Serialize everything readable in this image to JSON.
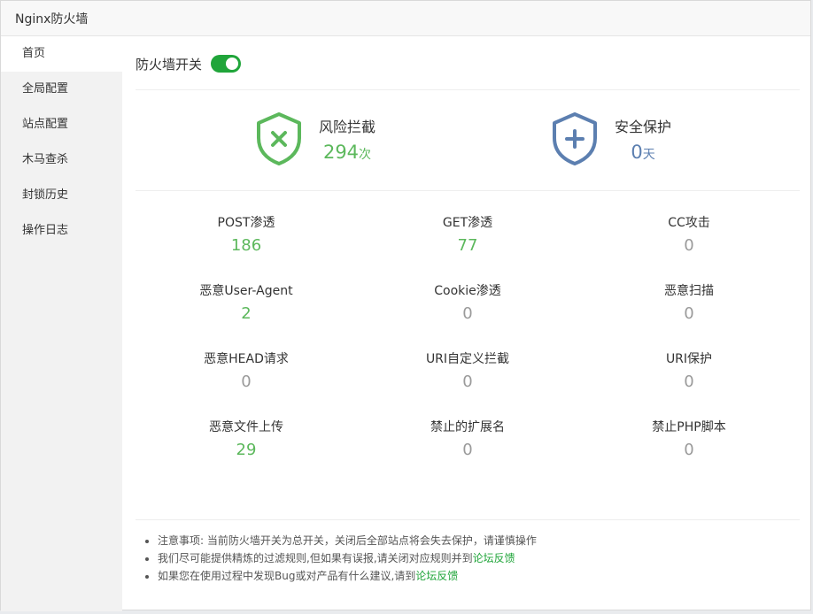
{
  "window": {
    "title": "Nginx防火墙"
  },
  "sidebar": {
    "items": [
      {
        "label": "首页"
      },
      {
        "label": "全局配置"
      },
      {
        "label": "站点配置"
      },
      {
        "label": "木马查杀"
      },
      {
        "label": "封锁历史"
      },
      {
        "label": "操作日志"
      }
    ]
  },
  "main": {
    "switch_label": "防火墙开关",
    "switch_on": true,
    "summary": [
      {
        "caption": "风险拦截",
        "value": "294",
        "unit": "次",
        "icon": "shield-x-icon",
        "color": "#5cb85c"
      },
      {
        "caption": "安全保护",
        "value": "0",
        "unit": "天",
        "icon": "shield-plus-icon",
        "color": "#5c7fb0"
      }
    ],
    "stats": [
      {
        "label": "POST渗透",
        "value": "186"
      },
      {
        "label": "GET渗透",
        "value": "77"
      },
      {
        "label": "CC攻击",
        "value": "0"
      },
      {
        "label": "恶意User-Agent",
        "value": "2"
      },
      {
        "label": "Cookie渗透",
        "value": "0"
      },
      {
        "label": "恶意扫描",
        "value": "0"
      },
      {
        "label": "恶意HEAD请求",
        "value": "0"
      },
      {
        "label": "URI自定义拦截",
        "value": "0"
      },
      {
        "label": "URI保护",
        "value": "0"
      },
      {
        "label": "恶意文件上传",
        "value": "29"
      },
      {
        "label": "禁止的扩展名",
        "value": "0"
      },
      {
        "label": "禁止PHP脚本",
        "value": "0"
      }
    ],
    "notes": [
      {
        "text": "注意事项: 当前防火墙开关为总开关，关闭后全部站点将会失去保护，请谨慎操作",
        "link": ""
      },
      {
        "text": "我们尽可能提供精炼的过滤规则,但如果有误报,请关闭对应规则并到",
        "link": "论坛反馈"
      },
      {
        "text": "如果您在使用过程中发现Bug或对产品有什么建议,请到",
        "link": "论坛反馈"
      }
    ]
  },
  "colors": {
    "accent": "#20a53a",
    "green": "#5cb85c",
    "blue": "#5c7fb0",
    "zero": "#9a9a9a"
  }
}
